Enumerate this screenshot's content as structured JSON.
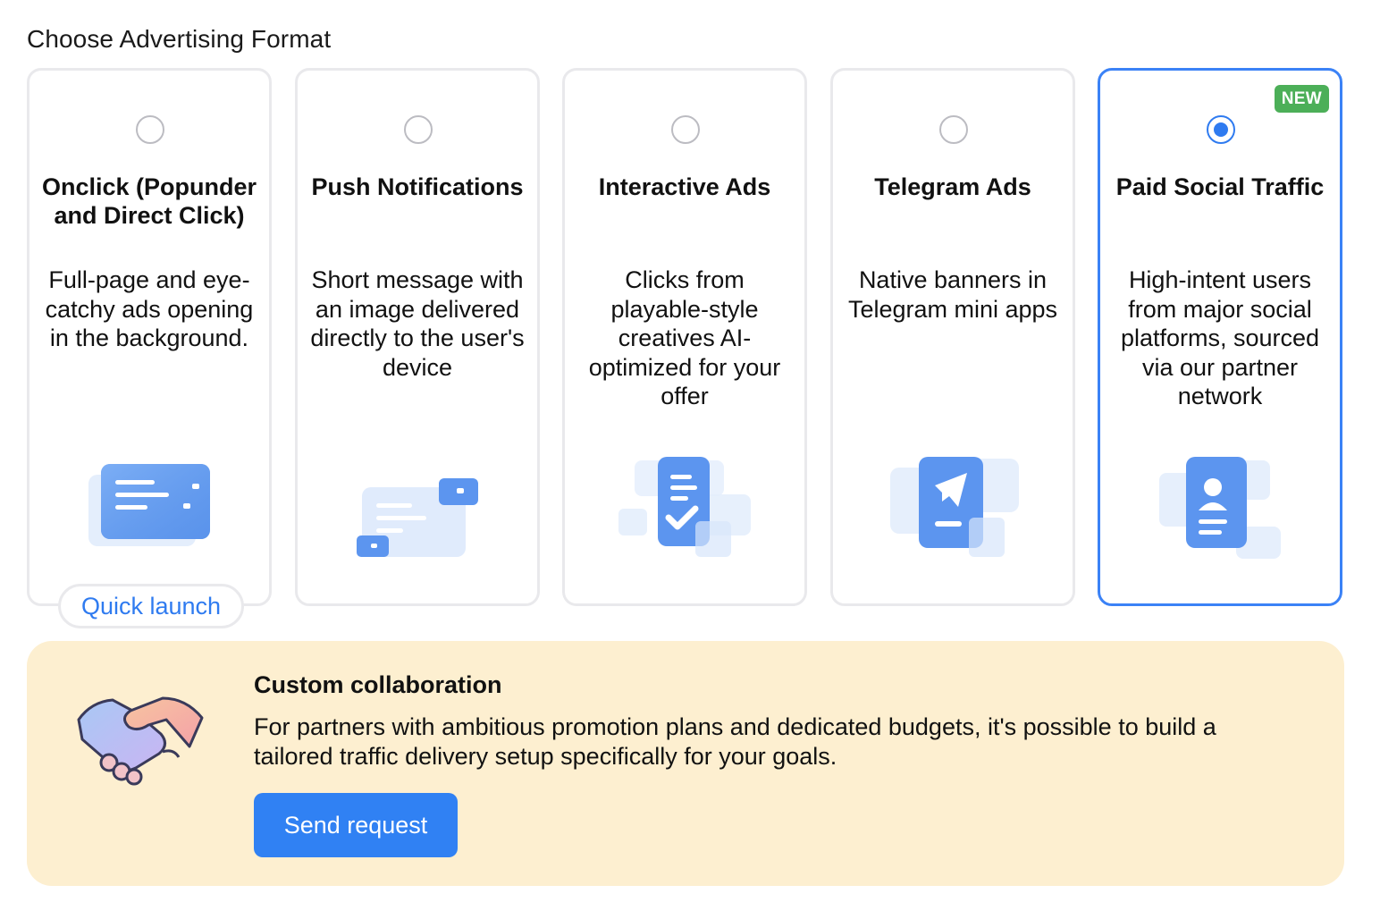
{
  "page": {
    "title": "Choose Advertising Format"
  },
  "formats": [
    {
      "title": "Onclick (Popunder and Direct Click)",
      "description": "Full-page and eye-catchy ads opening in the background.",
      "selected": false,
      "icon": "browser-window-icon",
      "extra_button": "Quick launch"
    },
    {
      "title": "Push Notifications",
      "description": "Short message with an image delivered directly to the user's device",
      "selected": false,
      "icon": "push-message-icon"
    },
    {
      "title": "Interactive Ads",
      "description": "Clicks from playable-style creatives AI-optimized for your offer",
      "selected": false,
      "icon": "checklist-icon"
    },
    {
      "title": "Telegram Ads",
      "description": "Native banners in Telegram mini apps",
      "selected": false,
      "icon": "telegram-plane-icon"
    },
    {
      "title": "Paid Social Traffic",
      "description": "High-intent users from major social platforms, sourced via our partner network",
      "selected": true,
      "badge": "NEW",
      "icon": "profile-card-icon"
    }
  ],
  "collab": {
    "title": "Custom collaboration",
    "text": "For partners with ambitious promotion plans and dedicated budgets, it's possible to build a tailored traffic delivery setup specifically for your goals.",
    "button": "Send request",
    "icon": "handshake-icon"
  },
  "colors": {
    "accent": "#3081f3",
    "selected_border": "#3b82f6",
    "badge": "#4caf58",
    "collab_bg": "#fdefd0",
    "card_border": "#e9e9ec"
  }
}
